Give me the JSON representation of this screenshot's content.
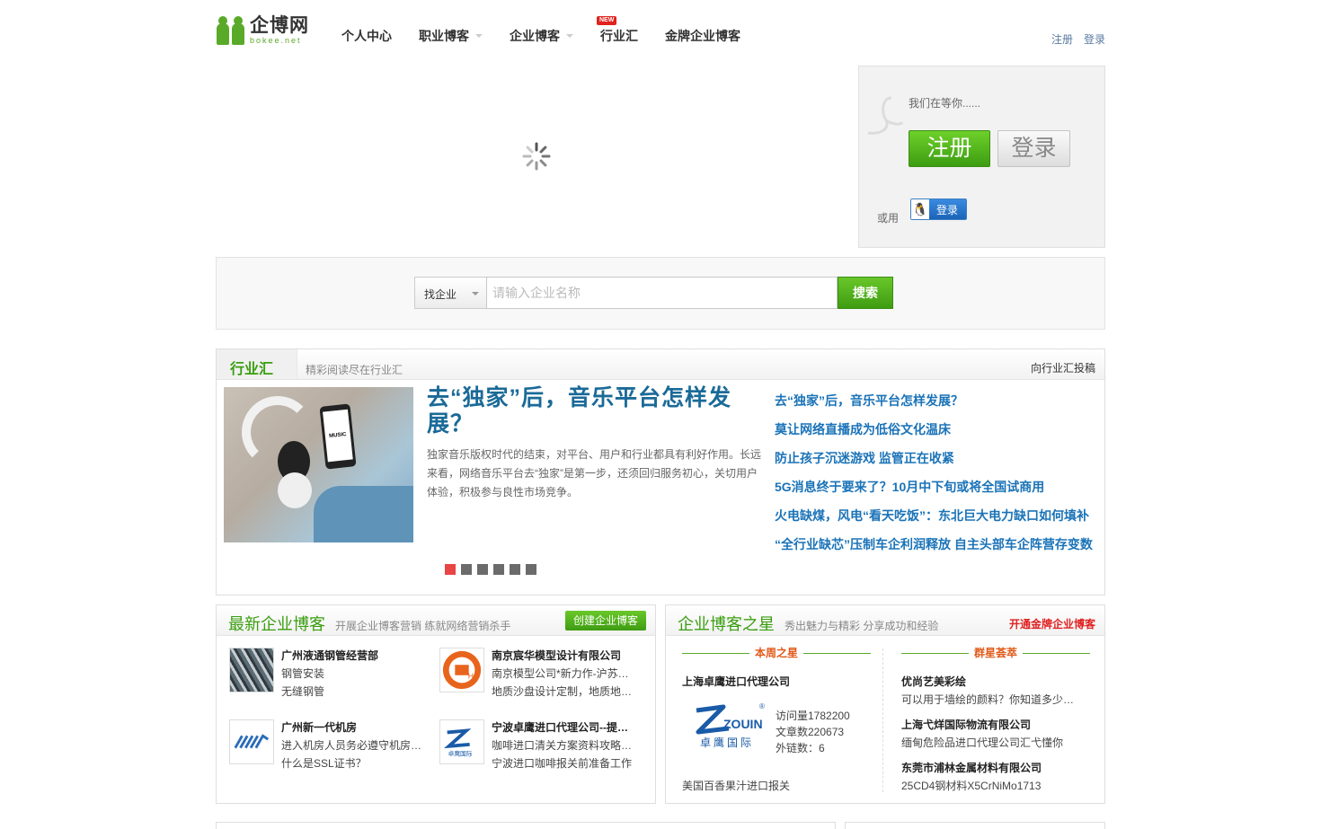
{
  "logo": {
    "cn": "企博网",
    "en": "bokee.net"
  },
  "nav": [
    {
      "label": "个人中心",
      "caret": false
    },
    {
      "label": "职业博客",
      "caret": true
    },
    {
      "label": "企业博客",
      "caret": true
    },
    {
      "label": "行业汇",
      "caret": false,
      "badge": "NEW"
    },
    {
      "label": "金牌企业博客",
      "caret": false
    }
  ],
  "header_links": {
    "register": "注册",
    "login": "登录"
  },
  "login_box": {
    "hint": "我们在等你......",
    "register_btn": "注册",
    "login_btn": "登录",
    "or_text": "或用",
    "qq_login": "登录"
  },
  "search": {
    "select_value": "找企业",
    "placeholder": "请输入企业名称",
    "button": "搜索"
  },
  "industry": {
    "title": "行业汇",
    "subtitle": "精彩阅读尽在行业汇",
    "link": "向行业汇投稿",
    "feature_title": "去“独家”后，音乐平台怎样发展？",
    "feature_desc": "独家音乐版权时代的结束，对平台、用户和行业都具有利好作用。长远来看，网络音乐平台去“独家”是第一步，还须回归服务初心，关切用户体验，积极参与良性市场竞争。",
    "image_label": "MUSIC",
    "news": [
      "去“独家”后，音乐平台怎样发展？",
      "莫让网络直播成为低俗文化温床",
      "防止孩子沉迷游戏 监管正在收紧",
      "5G消息终于要来了？10月中下旬或将全国试商用",
      "火电缺煤，风电“看天吃饭”：东北巨大电力缺口如何填补",
      "“全行业缺芯”压制车企利润释放 自主头部车企阵营存变数"
    ],
    "slide_count": 6,
    "active_slide": 1
  },
  "latest_blogs": {
    "title": "最新企业博客",
    "subtitle": "开展企业博客营销 练就网络营销杀手",
    "create_btn": "创建企业博客",
    "items": [
      {
        "name": "广州液通钢管经营部",
        "line1": "钢管安装",
        "line2": "无缝钢管",
        "thumb": "steel-pipes-photo"
      },
      {
        "name": "南京宸华模型设计有限公司",
        "line1": "南京模型公司*新力作-沪苏…",
        "line2": "地质沙盘设计定制，地质地…",
        "thumb": "chenhua-logo"
      },
      {
        "name": "广州新一代机房",
        "line1": "进入机房人员务必遵守机房…",
        "line2": "什么是SSL证书？",
        "thumb": "datacenter-logo"
      },
      {
        "name": "宁波卓鹰进口代理公司--提…",
        "line1": "咖啡进口清关方案资料攻略…",
        "line2": "宁波进口咖啡报关前准备工作",
        "thumb": "zouin-logo"
      }
    ]
  },
  "star_blogs": {
    "title": "企业博客之星",
    "subtitle": "秀出魅力与精彩 分享成功和经验",
    "link": "开通金牌企业博客",
    "weekly": {
      "heading": "本周之星",
      "name": "上海卓鹰进口代理公司",
      "logo_en": "ZOUIN",
      "logo_cn": "卓鹰国际",
      "visits": "访问量1782200",
      "articles": "文章数220673",
      "links": "外链数：6",
      "footer": "美国百香果汁进口报关"
    },
    "group": {
      "heading": "群星荟萃",
      "items": [
        {
          "name": "优尚艺美彩绘",
          "desc": "可以用于墙绘的颜料？你知道多少…"
        },
        {
          "name": "上海弋烊国际物流有限公司",
          "desc": "缅甸危险品进口代理公司汇弋懂你"
        },
        {
          "name": "东莞市浦林金属材料有限公司",
          "desc": "25CD4钢材料X5CrNiMo1713"
        }
      ]
    }
  },
  "colors": {
    "brand_green": "#3a9e10",
    "link_blue": "#1a73b8",
    "accent_red": "#e02020"
  }
}
